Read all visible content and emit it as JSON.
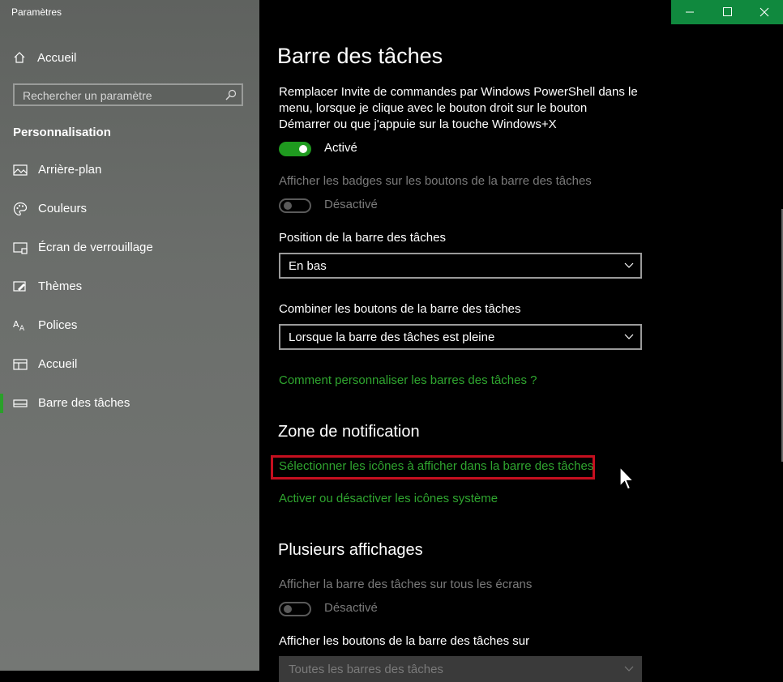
{
  "window": {
    "title": "Paramètres"
  },
  "sidebar": {
    "home_label": "Accueil",
    "search_placeholder": "Rechercher un paramètre",
    "section": "Personnalisation",
    "items": [
      {
        "label": "Arrière-plan",
        "icon": "image-icon"
      },
      {
        "label": "Couleurs",
        "icon": "palette-icon"
      },
      {
        "label": "Écran de verrouillage",
        "icon": "lock-screen-icon"
      },
      {
        "label": "Thèmes",
        "icon": "brush-icon"
      },
      {
        "label": "Polices",
        "icon": "font-icon"
      },
      {
        "label": "Accueil",
        "icon": "start-icon"
      },
      {
        "label": "Barre des tâches",
        "icon": "taskbar-icon",
        "active": true
      }
    ]
  },
  "titlebar": {
    "accent": "#10893e"
  },
  "main": {
    "title": "Barre des tâches",
    "powershell": {
      "text_line1": "Remplacer Invite de commandes par Windows PowerShell dans le",
      "text_line2": "menu, lorsque je clique avec le bouton droit sur le bouton",
      "text_line3": "Démarrer ou que j'appuie sur la touche Windows+X",
      "state": "Activé"
    },
    "badges": {
      "text": "Afficher les badges sur les boutons de la barre des tâches",
      "state": "Désactivé"
    },
    "position": {
      "label": "Position de la barre des tâches",
      "value": "En bas"
    },
    "combine": {
      "label": "Combiner les boutons de la barre des tâches",
      "value": "Lorsque la barre des tâches est pleine"
    },
    "help_link": "Comment personnaliser les barres des tâches ?",
    "notification": {
      "heading": "Zone de notification",
      "link1": "Sélectionner les icônes à afficher dans la barre des tâches",
      "link2": "Activer ou désactiver les icônes système"
    },
    "multi": {
      "heading": "Plusieurs affichages",
      "show_all_text": "Afficher la barre des tâches sur tous les écrans",
      "show_all_state": "Désactivé",
      "buttons_label": "Afficher les boutons de la barre des tâches sur",
      "buttons_value": "Toutes les barres des tâches"
    }
  },
  "colors": {
    "accent_green": "#2fa52f",
    "highlight_red": "#c50f1f"
  }
}
